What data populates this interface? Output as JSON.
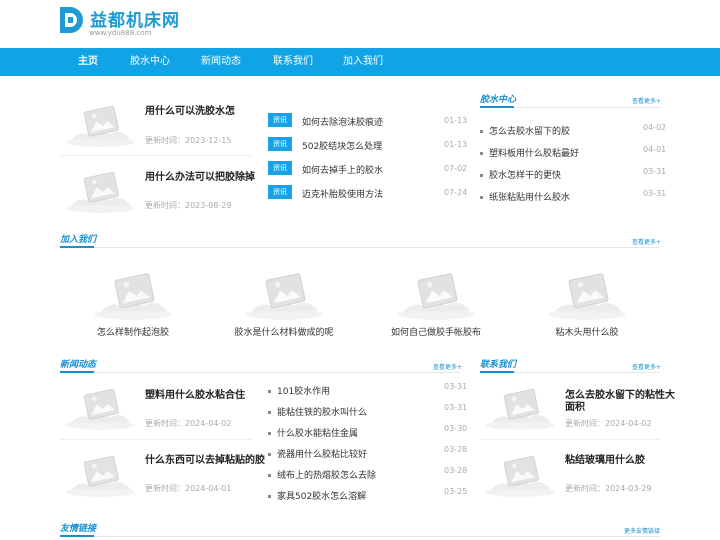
{
  "site": {
    "logo_text": "益都机床网",
    "logo_url": "www.ydu888.com"
  },
  "nav": {
    "items": [
      "主页",
      "胶水中心",
      "新闻动态",
      "联系我们",
      "加入我们"
    ]
  },
  "top_cards": [
    {
      "title": "用什么可以洗胶水怎",
      "date": "更新时间：2023-12-15"
    },
    {
      "title": "用什么办法可以把胶除掉",
      "date": "更新时间：2023-08-29"
    }
  ],
  "tag_news": {
    "tag_label": "资讯",
    "items": [
      {
        "title": "如何去除泡沫胶痕迹",
        "date": "01-13"
      },
      {
        "title": "502胶结块怎么处理",
        "date": "01-13"
      },
      {
        "title": "如何去掉手上的胶水",
        "date": "07-02"
      },
      {
        "title": "迈克补胎胶使用方法",
        "date": "07-24"
      }
    ]
  },
  "glue_center": {
    "title": "胶水中心",
    "more": "查看更多+",
    "items": [
      {
        "title": "怎么去胶水留下的胶",
        "date": "04-02"
      },
      {
        "title": "塑料板用什么胶粘最好",
        "date": "04-01"
      },
      {
        "title": "胶水怎样干的更快",
        "date": "03-31"
      },
      {
        "title": "纸张粘贴用什么胶水",
        "date": "03-31"
      }
    ]
  },
  "join_us": {
    "title": "加入我们",
    "more": "查看更多+",
    "items": [
      "怎么样制作起泡胶",
      "胶水是什么材料做成的呢",
      "如何自己做胶手帐胶布",
      "粘木头用什么胶"
    ]
  },
  "news": {
    "title": "新闻动态",
    "more": "查看更多+",
    "cards": [
      {
        "title": "塑料用什么胶水粘合住",
        "date": "更新时间：2024-04-02"
      },
      {
        "title": "什么东西可以去掉粘贴的胶",
        "date": "更新时间：2024-04-01"
      }
    ],
    "list": [
      {
        "title": "101胶水作用",
        "date": "03-31"
      },
      {
        "title": "能粘住铁的胶水叫什么",
        "date": "03-31"
      },
      {
        "title": "什么胶水能粘住金属",
        "date": "03-30"
      },
      {
        "title": "瓷器用什么胶粘比较好",
        "date": "03-28"
      },
      {
        "title": "绒布上的热熔胶怎么去除",
        "date": "03-28"
      },
      {
        "title": "家具502胶水怎么溶解",
        "date": "03-25"
      }
    ]
  },
  "contact": {
    "title": "联系我们",
    "more": "查看更多+",
    "cards": [
      {
        "title": "怎么去胶水留下的粘性大",
        "title2": "面积",
        "date": "更新时间：2024-04-02"
      },
      {
        "title": "粘结玻璃用什么胶",
        "date": "更新时间：2024-03-29"
      }
    ]
  },
  "links": {
    "title": "友情链接",
    "more": "更多友情链接"
  },
  "colors": {
    "brand": "#10a3e5",
    "accent": "#1a8fd0"
  }
}
